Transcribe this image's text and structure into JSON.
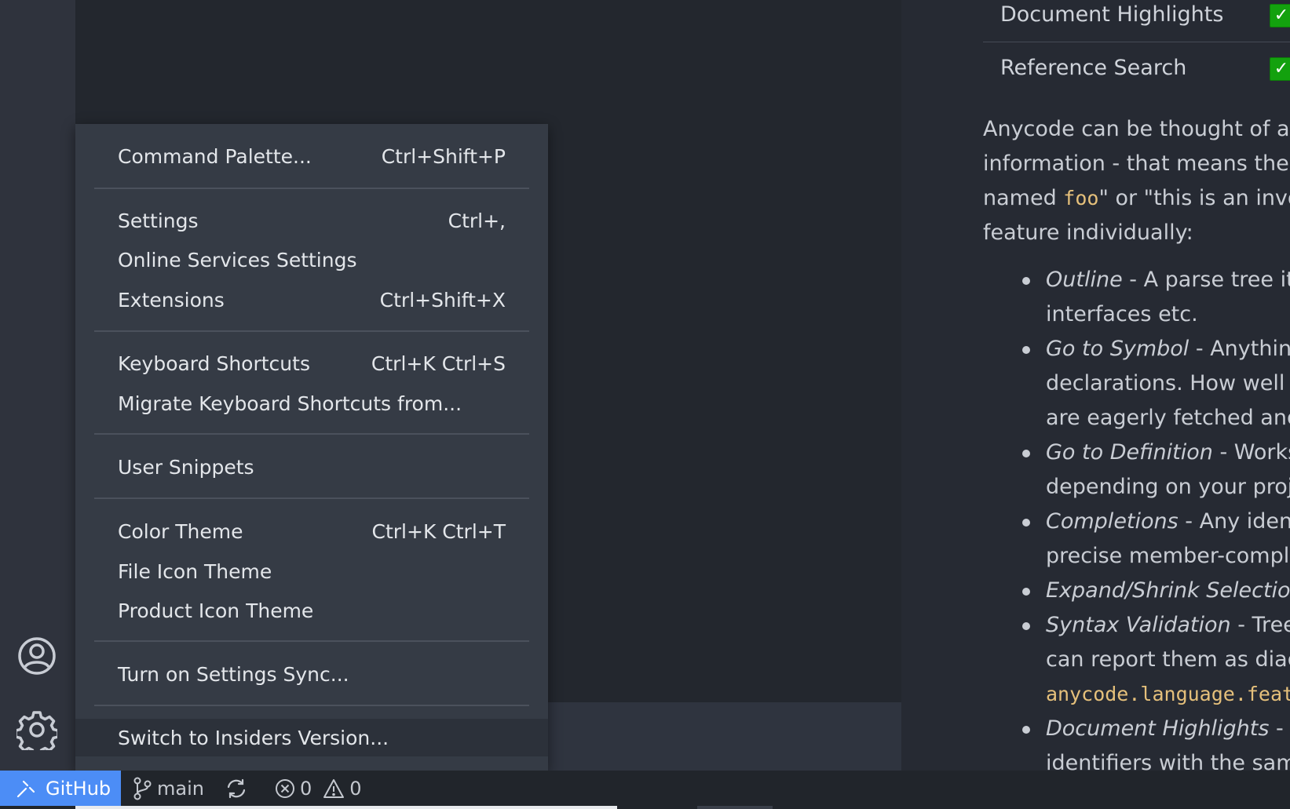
{
  "settings": {
    "rows": [
      {
        "label": "Document Highlights",
        "checked": true
      },
      {
        "label": "Reference Search",
        "checked": true
      }
    ],
    "description": {
      "line1": "Anycode can be thought of as b",
      "line2": "information - that means there i",
      "line3_pre": "named ",
      "line3_code": "foo",
      "line3_post": "\" or \"this is an invoca",
      "line4": "feature individually:"
    },
    "bullets": [
      {
        "term": "Outline",
        "text": " - A parse tree itse",
        "cont": "interfaces etc."
      },
      {
        "term": "Go to Symbol",
        "text": " - Anything t",
        "cont": "declarations. How well th",
        "cont2": "are eagerly fetched and a"
      },
      {
        "term": "Go to Definition",
        "text": " - Works j",
        "cont": "depending on your proje"
      },
      {
        "term": "Completions",
        "text": " - Any identif",
        "cont": "precise member-complet"
      },
      {
        "term": "Expand/Shrink Selection",
        "text": " -"
      },
      {
        "term": "Syntax Validation",
        "text": " - Tree-s",
        "cont": "can report them as diagn",
        "cont_code": "anycode.language.feat"
      },
      {
        "term": "Document Highlights",
        "text": " - Fo",
        "cont": "identifiers with the same"
      }
    ]
  },
  "menu": {
    "items": [
      {
        "label": "Command Palette...",
        "shortcut": "Ctrl+Shift+P"
      },
      {
        "label": "Settings",
        "shortcut": "Ctrl+,"
      },
      {
        "label": "Online Services Settings",
        "shortcut": ""
      },
      {
        "label": "Extensions",
        "shortcut": "Ctrl+Shift+X"
      },
      {
        "label": "Keyboard Shortcuts",
        "shortcut": "Ctrl+K Ctrl+S"
      },
      {
        "label": "Migrate Keyboard Shortcuts from...",
        "shortcut": ""
      },
      {
        "label": "User Snippets",
        "shortcut": ""
      },
      {
        "label": "Color Theme",
        "shortcut": "Ctrl+K Ctrl+T"
      },
      {
        "label": "File Icon Theme",
        "shortcut": ""
      },
      {
        "label": "Product Icon Theme",
        "shortcut": ""
      },
      {
        "label": "Turn on Settings Sync...",
        "shortcut": ""
      },
      {
        "label": "Switch to Insiders Version...",
        "shortcut": ""
      }
    ]
  },
  "activity": {
    "icons": [
      "account-icon",
      "gear-icon"
    ]
  },
  "status_bar": {
    "remote_label": "GitHub",
    "branch": "main",
    "errors": "0",
    "warnings": "0"
  },
  "colors": {
    "remote_bg": "#4c8df6",
    "check_green": "#13a10e",
    "code_yellow": "#e5c07b"
  }
}
